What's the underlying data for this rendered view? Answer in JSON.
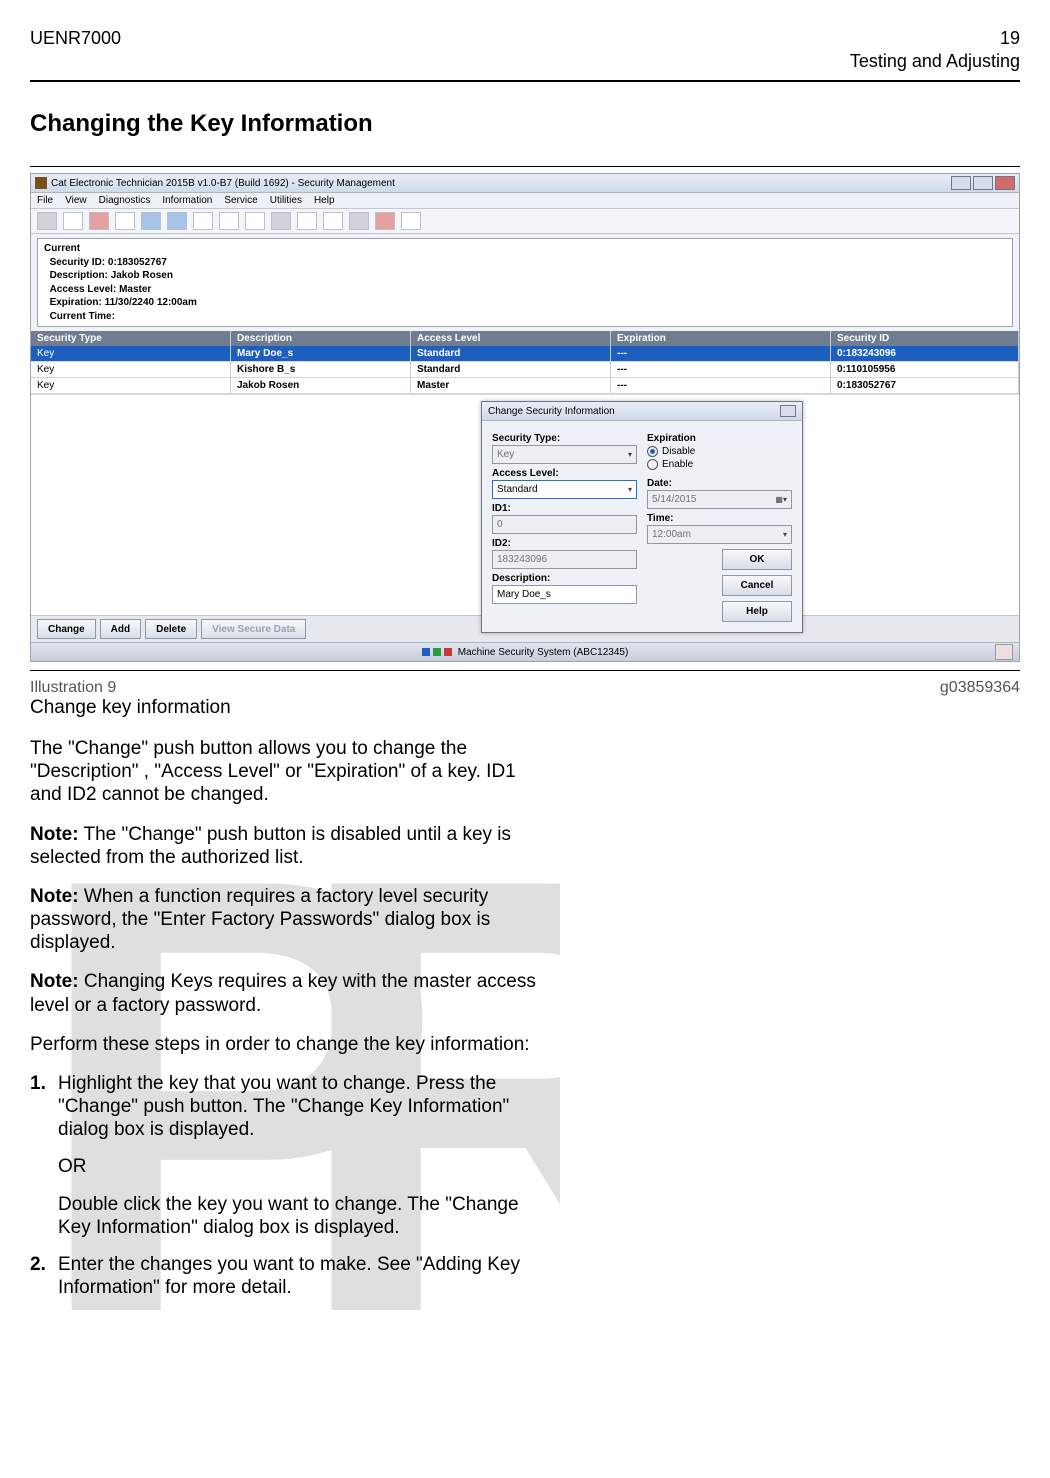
{
  "doc": {
    "code": "UENR7000",
    "page_no": "19",
    "section": "Testing and Adjusting"
  },
  "heading": "Changing the Key Information",
  "app": {
    "title": "Cat Electronic Technician 2015B v1.0-B7 (Build 1692) - Security Management",
    "menu": [
      "File",
      "View",
      "Diagnostics",
      "Information",
      "Service",
      "Utilities",
      "Help"
    ]
  },
  "current": {
    "caption": "Current",
    "labels": {
      "sec_id": "Security ID:",
      "desc": "Description:",
      "access": "Access Level:",
      "exp": "Expiration:",
      "time": "Current Time:"
    },
    "sec_id": "0:183052767",
    "desc": "Jakob Rosen",
    "access": "Master",
    "exp": "11/30/2240 12:00am",
    "time": ""
  },
  "grid": {
    "headers": {
      "type": "Security Type",
      "desc": "Description",
      "access": "Access Level",
      "exp": "Expiration",
      "id": "Security ID"
    },
    "rows": [
      {
        "type": "Key",
        "desc": "Mary Doe_s",
        "access": "Standard",
        "exp": "---",
        "id": "0:183243096",
        "selected": true
      },
      {
        "type": "Key",
        "desc": "Kishore B_s",
        "access": "Standard",
        "exp": "---",
        "id": "0:110105956",
        "selected": false
      },
      {
        "type": "Key",
        "desc": "Jakob Rosen",
        "access": "Master",
        "exp": "---",
        "id": "0:183052767",
        "selected": false
      }
    ]
  },
  "dialog": {
    "title": "Change Security Information",
    "labels": {
      "sec_type": "Security Type:",
      "access": "Access Level:",
      "id1": "ID1:",
      "id2": "ID2:",
      "desc": "Description:",
      "exp": "Expiration",
      "disable": "Disable",
      "enable": "Enable",
      "date": "Date:",
      "time": "Time:"
    },
    "values": {
      "sec_type": "Key",
      "access": "Standard",
      "id1": "0",
      "id2": "183243096",
      "desc": "Mary Doe_s",
      "date": "5/14/2015",
      "time": "12:00am"
    },
    "buttons": {
      "ok": "OK",
      "cancel": "Cancel",
      "help": "Help"
    }
  },
  "footer_buttons": {
    "change": "Change",
    "add": "Add",
    "delete": "Delete",
    "view": "View Secure Data"
  },
  "statusbar": "Machine Security System (ABC12345)",
  "caption": {
    "left": "Illustration 9",
    "right": "g03859364",
    "sub": "Change key information"
  },
  "body": {
    "p1": "The  \"Change\"  push button allows you to change the \"Description\" ,  \"Access Level\"  or  \"Expiration\"  of a key. ID1 and ID2 cannot be changed.",
    "n1_label": "Note:",
    "n1": " The  \"Change\"  push button is disabled until a key is selected from the authorized list.",
    "n2_label": "Note:",
    "n2": " When a function requires a factory level security password, the  \"Enter Factory Passwords\" dialog box is displayed.",
    "n3_label": "Note:",
    "n3": " Changing Keys requires a key with the master access level or a factory password.",
    "p2": "Perform these steps in order to change the key information:",
    "s1_num": "1.",
    "s1": "Highlight the key that you want to change. Press the  \"Change\"  push button. The  \"Change Key Information\"  dialog box is displayed.",
    "s1_or": "OR",
    "s1b": "Double click the key you want to change. The \"Change Key Information\"  dialog box is displayed.",
    "s2_num": "2.",
    "s2": "Enter the changes you want to make. See \"Adding Key Information\" for more detail."
  }
}
